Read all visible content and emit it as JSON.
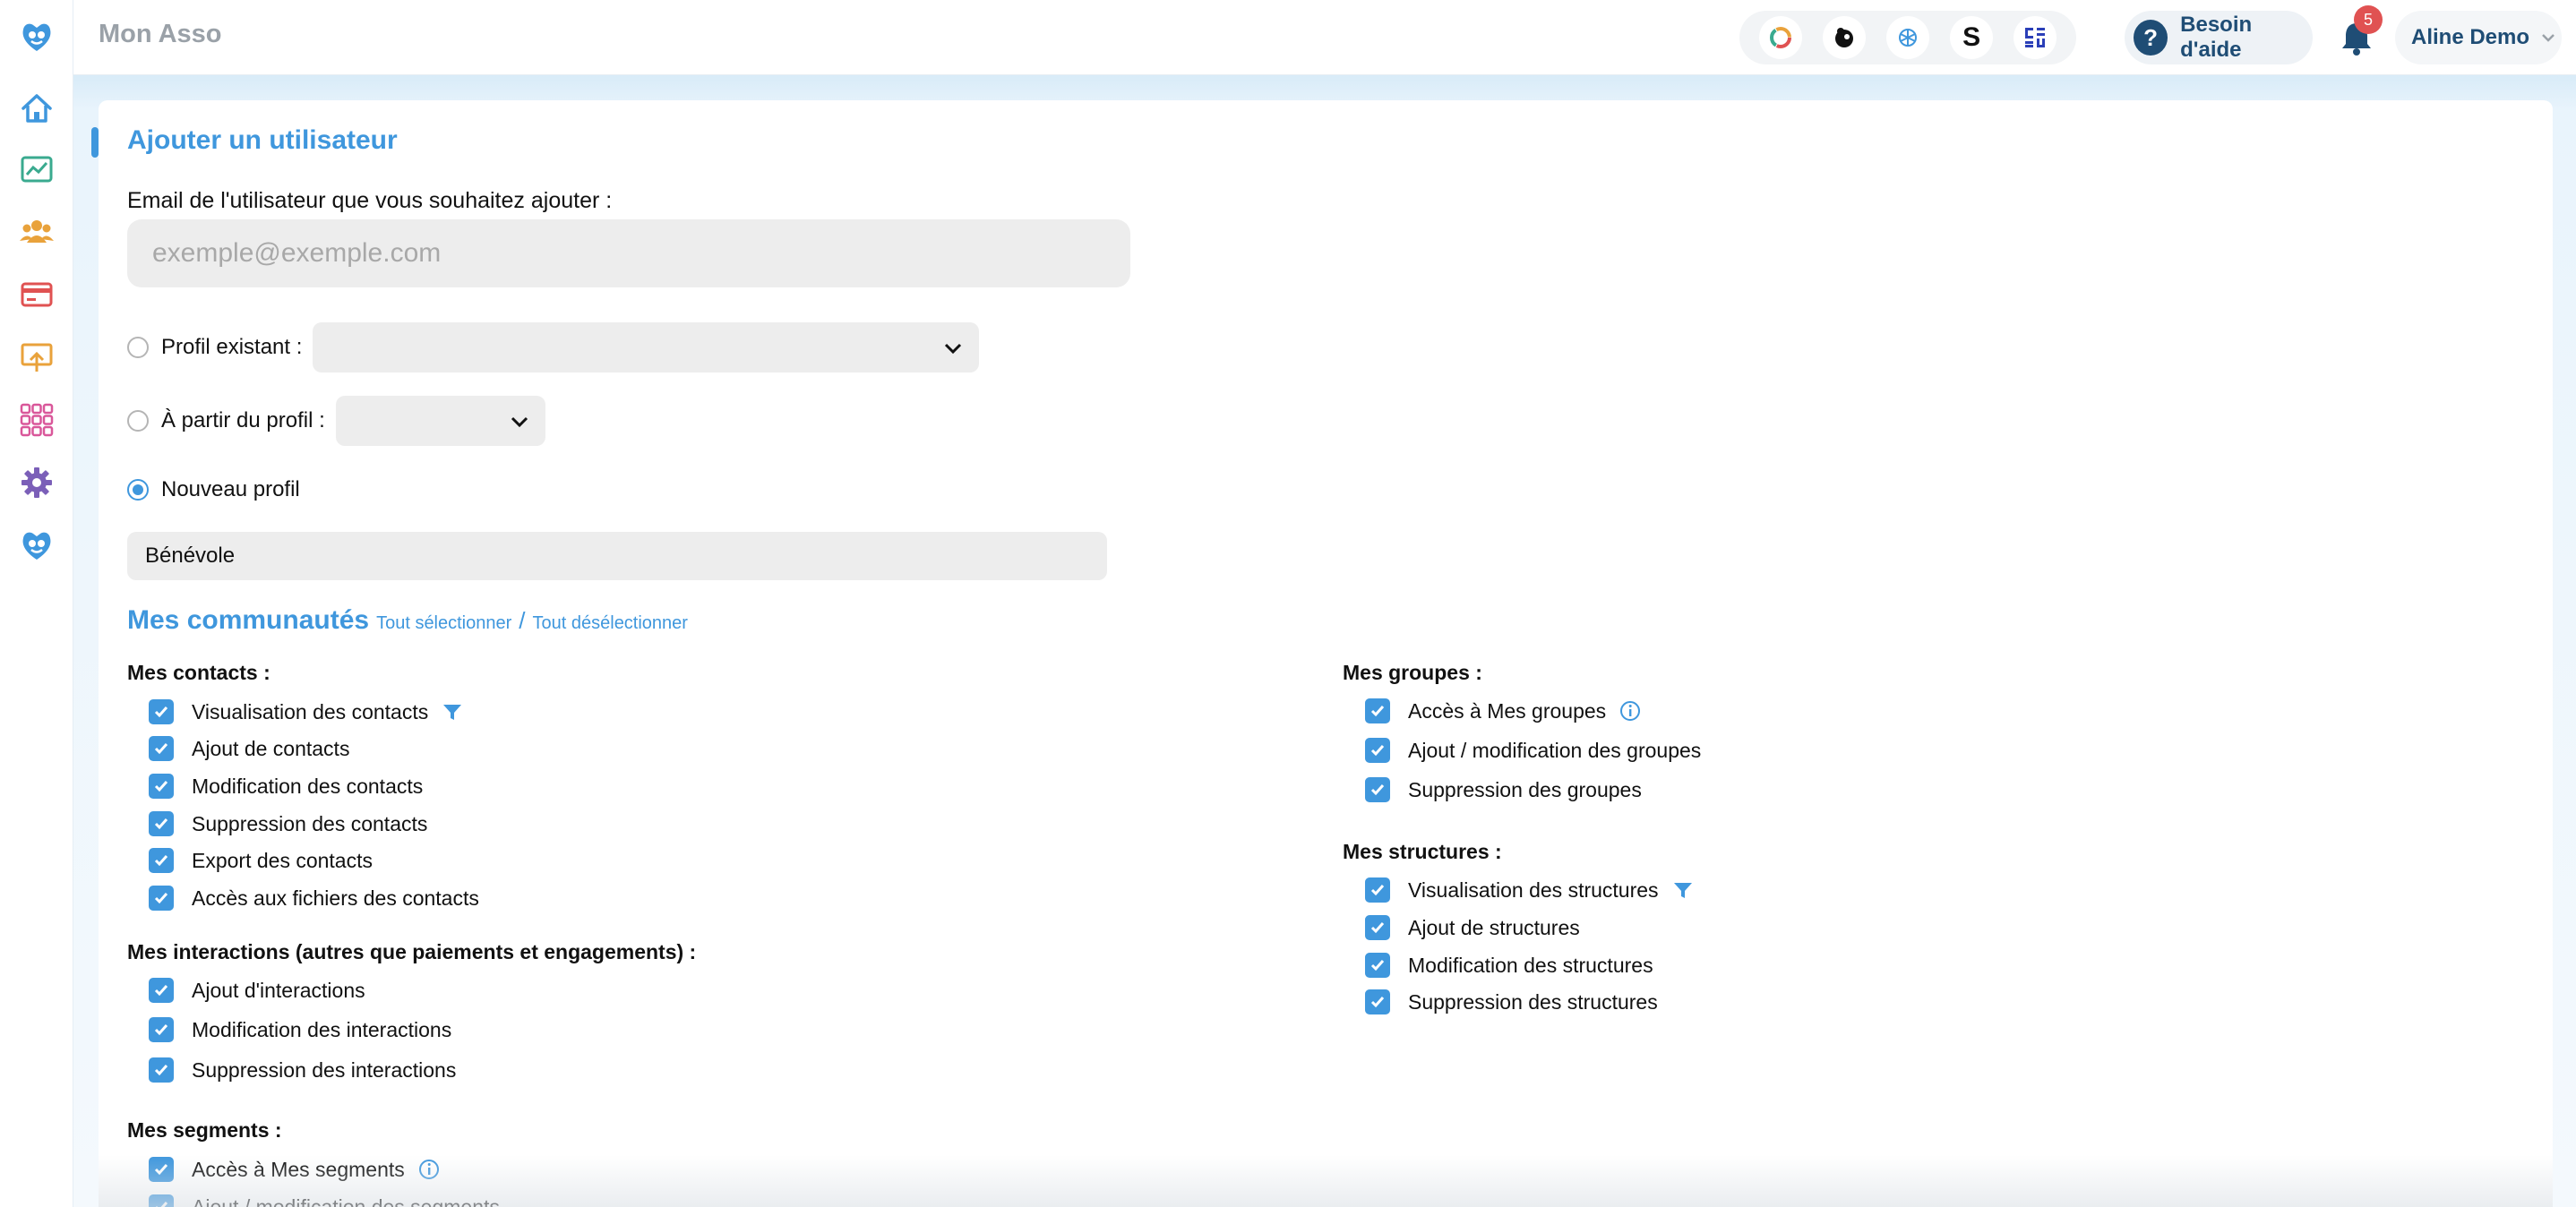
{
  "header": {
    "app_title": "Mon Asso",
    "integration_s_label": "S",
    "help_label": "Besoin d'aide",
    "help_symbol": "?",
    "notification_count": "5",
    "user_name": "Aline Demo"
  },
  "sidebar": {
    "items": [
      "home-icon",
      "dashboard-icon",
      "contacts-icon",
      "payments-icon",
      "campaigns-icon",
      "apps-icon",
      "settings-icon",
      "brand-icon"
    ]
  },
  "form": {
    "title": "Ajouter un utilisateur",
    "email_label": "Email de l'utilisateur que vous souhaitez ajouter :",
    "email_placeholder": "exemple@exemple.com",
    "radio_existing_label": "Profil existant :",
    "radio_from_label": "À partir du profil :",
    "radio_new_label": "Nouveau profil",
    "selected_option": "Nouveau profil",
    "profile_name_value": "Bénévole"
  },
  "communities": {
    "title": "Mes communautés",
    "select_all": "Tout sélectionner",
    "separator": "/",
    "deselect_all": "Tout désélectionner",
    "contacts": {
      "heading": "Mes contacts :",
      "items": [
        "Visualisation des contacts",
        "Ajout de contacts",
        "Modification des contacts",
        "Suppression des contacts",
        "Export des contacts",
        "Accès aux fichiers des contacts"
      ]
    },
    "interactions": {
      "heading": "Mes interactions (autres que paiements et engagements) :",
      "items": [
        "Ajout d'interactions",
        "Modification des interactions",
        "Suppression des interactions"
      ]
    },
    "segments": {
      "heading": "Mes segments :",
      "items": [
        "Accès à Mes segments",
        "Ajout / modification des segments"
      ]
    },
    "groups": {
      "heading": "Mes groupes :",
      "items": [
        "Accès à Mes groupes",
        "Ajout / modification des groupes",
        "Suppression des groupes"
      ]
    },
    "structures": {
      "heading": "Mes structures :",
      "items": [
        "Visualisation des structures",
        "Ajout de structures",
        "Modification des structures",
        "Suppression des structures"
      ]
    }
  },
  "colors": {
    "accent": "#3f97dd",
    "navy": "#1f4d75",
    "badge": "#e05252",
    "input_bg": "#ededed"
  }
}
